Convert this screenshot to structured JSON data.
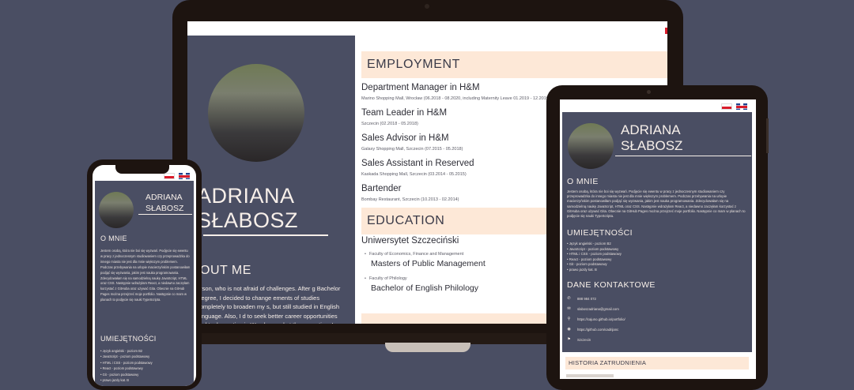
{
  "person": {
    "first_name": "ADRIANA",
    "last_name": "SŁABOSZ",
    "laptop_name_first": "ADRIANA",
    "laptop_name_last": "SŁABOSZ"
  },
  "laptop": {
    "about_heading": "OUT ME",
    "about_text": "erson, who is not afraid of challenges. After g Bachelor Degree, I decided to change ements of studies completely to broaden my s, but still studied in English language. Also, I d to seek better career opportunities and took on ation in Wrocław and at the same time I was ued studies in Szczecin. During my maternity leave",
    "employment_heading": "EMPLOYMENT",
    "jobs": [
      {
        "title": "Department Manager in H&M",
        "sub": "Marino Shopping Mall, Wrocław (06.2018 - 08.2020, including Maternity Leave 01.2019 - 12.2019)"
      },
      {
        "title": "Team Leader in H&M",
        "sub": "Szczecin (02.2018 - 05.2018)"
      },
      {
        "title": "Sales Advisor in H&M",
        "sub": "Galaxy Shopping Mall, Szczecin (07.2015 - 05.2018)"
      },
      {
        "title": "Sales Assistant in Reserved",
        "sub": "Kaskada Shopping Mall, Szczecin (03.2014 - 05.2015)"
      },
      {
        "title": "Bartender",
        "sub": "Bombay Restaurant, Szczecin (10.2013 - 02.2014)"
      }
    ],
    "education_heading": "EDUCATION",
    "school": "Uniwersytet Szczeciński",
    "faculties": [
      {
        "faculty": "Faculty of Economics, Finance and Management",
        "degree": "Masters of Public Management"
      },
      {
        "faculty": "Faculty of Philology",
        "degree": "Bachelor of English Philology"
      }
    ]
  },
  "tablet": {
    "about_heading": "O MNIE",
    "about_text": "Jestem osobą, która nie boi się wyzwań. Podjęcie się ewentu w pracy z jednoczesnym studiowaniem czy przeprowadzka do innego miasta nie jest dla mnie większym problemem. Podczas przebywania na urlopie macierzyńskim postanowiłam podjąć się wyzwania, jakim jest nauka programowania. Zdecydowałam się na samodzielną naukę JavaScript, HTML oraz CSS. Następnie wdrażyłam React, a niedawno zaczęłam korzystać z GitHuba oraz używać Gita. Obecnie na GitHub Pages można przejrzeć moje portfolio. Następnie co mam w planach to podjęcie się nauki TypeScripta.",
    "skills_heading": "UMIEJĘTNOŚCI",
    "skills": [
      "Język angielski - poziom B2",
      "JavaScript - poziom podstawowy",
      "HTML i CSS - poziom podstawowy",
      "React - poziom podstawowy",
      "Git - poziom podstawowy",
      "prawo jazdy kat. B"
    ],
    "contact_heading": "DANE KONTAKTOWE",
    "contacts": [
      {
        "icon": "phone-icon",
        "glyph": "✆",
        "text": "888 984 072"
      },
      {
        "icon": "email-icon",
        "glyph": "✉",
        "text": "slaboszadriana@gmail.com"
      },
      {
        "icon": "link-icon",
        "glyph": "⚲",
        "text": "https://cajuno.github.io/portfolio/"
      },
      {
        "icon": "github-icon",
        "glyph": "◉",
        "text": "https://github.com/cadrijanc"
      },
      {
        "icon": "location-icon",
        "glyph": "⚑",
        "text": "Szczecin"
      }
    ],
    "history_heading": "HISTORIA ZATRUDNIENIA"
  },
  "phone": {
    "about_heading": "O MNIE",
    "about_text": "Jestem osobą, która nie boi się wyzwań. Podjęcie się ewentu w pracy z jednoczesnym studiowaniem czy przeprowadzka do innego miasta nie jest dla mnie większym problemem. Podczas przebywania na urlopie macierzyńskim postanowiłam podjąć się wyzwania, jakim jest nauka programowania. Zdecydowałam się na samodzielną naukę JavaScript, HTML oraz CSS. Następnie wdrażyłam React, a niedawno zaczęłam korzystać z GitHuba oraz używać Gita. Obecnie na GitHub Pages można przejrzeć moje portfolio. Następnie co mam w planach to podjęcie się nauki TypeScripta.",
    "skills_heading": "UMIEJĘTNOŚCI",
    "skills": [
      "Język angielski - poziom B2",
      "JavaScript - poziom podstawowy",
      "HTML i CSS - poziom podstawowy",
      "React - poziom podstawowy",
      "Git - poziom podstawowy",
      "prawo jazdy kat. B"
    ]
  },
  "colors": {
    "background": "#4a4e63",
    "panel": "#4a4e63",
    "accent_band": "#fde8d7",
    "device_frame": "#1d1410"
  }
}
